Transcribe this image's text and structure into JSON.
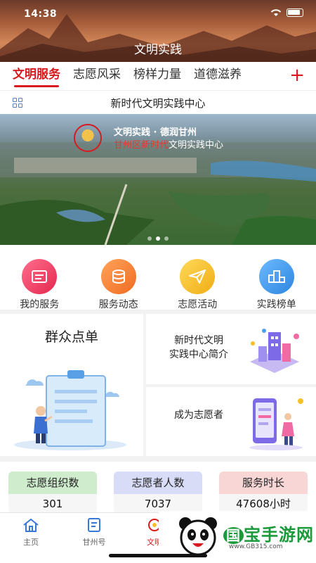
{
  "status_bar": {
    "time": "14:38"
  },
  "header": {
    "title": "文明实践"
  },
  "tabs": [
    {
      "label": "文明服务",
      "active": true
    },
    {
      "label": "志愿风采",
      "active": false
    },
    {
      "label": "榜样力量",
      "active": false
    },
    {
      "label": "道德滋养",
      "active": false
    }
  ],
  "tab_add_icon": "plus-icon",
  "section": {
    "title": "新时代文明实践中心"
  },
  "banner": {
    "line1": "文明实践 · 德润甘州",
    "line2_highlight": "甘州区新时代",
    "line2_rest": "文明实践中心"
  },
  "quick_actions": [
    {
      "label": "我的服务",
      "icon": "document-icon",
      "color": "#f0446a"
    },
    {
      "label": "服务动态",
      "icon": "coins-icon",
      "color": "#f58a3a"
    },
    {
      "label": "志愿活动",
      "icon": "paper-plane-icon",
      "color": "#f5c12a"
    },
    {
      "label": "实践榜单",
      "icon": "podium-icon",
      "color": "#4aa0f0"
    }
  ],
  "cards": {
    "left_title": "群众点单",
    "intro_line1": "新时代文明",
    "intro_line2": "实践中心简介",
    "volunteer": "成为志愿者"
  },
  "stats": [
    {
      "label": "志愿组织数",
      "value": "301",
      "color": "#cfeccd"
    },
    {
      "label": "志愿者人数",
      "value": "7037",
      "color": "#d9dcf7"
    },
    {
      "label": "服务时长",
      "value": "47608小时",
      "color": "#f8d6d6"
    }
  ],
  "bottom_nav": [
    {
      "label": "主页",
      "icon": "home-icon"
    },
    {
      "label": "甘州号",
      "icon": "news-icon"
    },
    {
      "label": "文明",
      "icon": "civilization-icon"
    }
  ],
  "watermark": {
    "brand": "宝手游网",
    "url": "www.GB315.com"
  }
}
